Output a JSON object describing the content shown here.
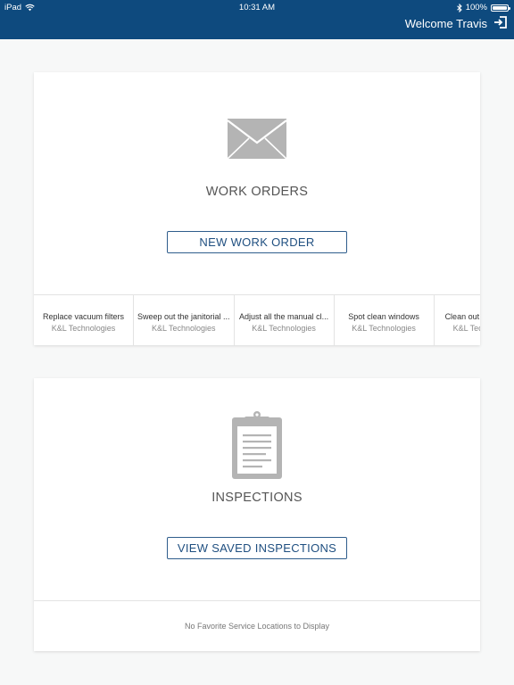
{
  "status_bar": {
    "device": "iPad",
    "time": "10:31 AM",
    "battery": "100%",
    "icons": [
      "wifi-icon",
      "bluetooth-icon",
      "battery-icon"
    ]
  },
  "header": {
    "welcome": "Welcome Travis",
    "logout_icon": "logout-icon",
    "background_color": "#0e4a7e"
  },
  "work_orders": {
    "icon": "envelope-icon",
    "title": "WORK ORDERS",
    "button_label": "NEW WORK ORDER",
    "recent": [
      {
        "title": "Replace vacuum filters",
        "company": "K&L Technologies"
      },
      {
        "title": "Sweep out the janitorial ...",
        "company": "K&L Technologies"
      },
      {
        "title": "Adjust all the manual cl...",
        "company": "K&L Technologies"
      },
      {
        "title": "Spot clean windows",
        "company": "K&L Technologies"
      },
      {
        "title": "Clean out",
        "company": "K&L Tec"
      }
    ]
  },
  "inspections": {
    "icon": "clipboard-icon",
    "title": "INSPECTIONS",
    "button_label": "VIEW SAVED INSPECTIONS",
    "empty_message": "No Favorite Service Locations to Display"
  },
  "accent_color": "#1f4f80"
}
